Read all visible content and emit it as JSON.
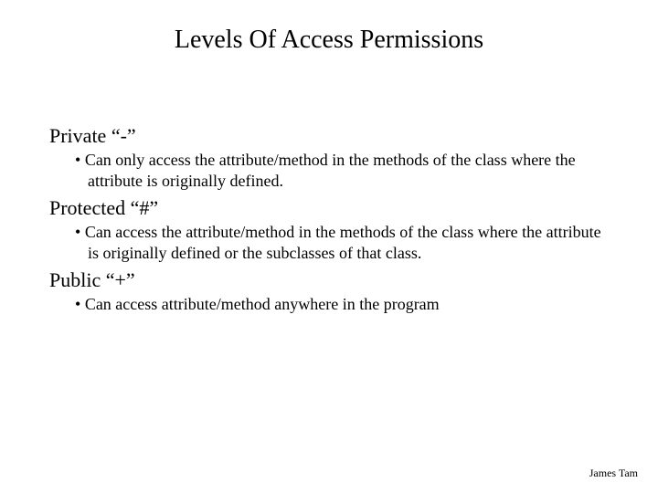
{
  "title": "Levels Of Access Permissions",
  "sections": [
    {
      "heading": "Private “-”",
      "bullet": "Can only access the attribute/method in the methods of the class where the attribute is originally defined."
    },
    {
      "heading": "Protected “#”",
      "bullet": "Can access the attribute/method in the methods of the class where the attribute is originally defined or the subclasses of that class."
    },
    {
      "heading": "Public “+”",
      "bullet": "Can access attribute/method anywhere in the program"
    }
  ],
  "footer": "James Tam"
}
